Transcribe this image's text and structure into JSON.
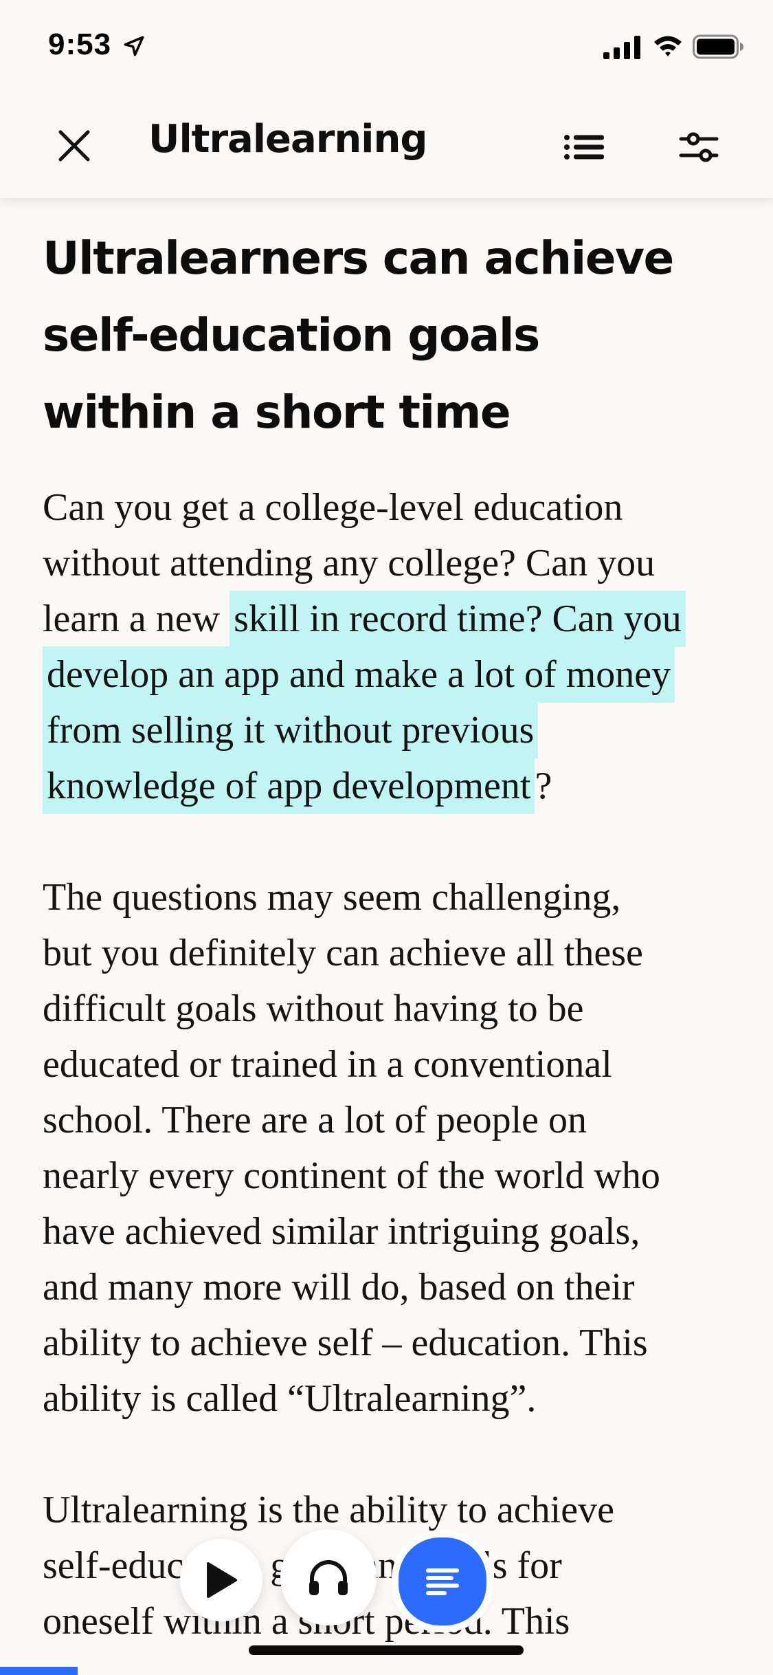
{
  "status_bar": {
    "time": "9:53",
    "icons": [
      "location-arrow-icon",
      "cellular-signal-icon",
      "wifi-icon",
      "battery-icon"
    ]
  },
  "header": {
    "title": "Ultralearning",
    "icons": [
      "close-icon",
      "list-icon",
      "settings-sliders-icon"
    ]
  },
  "chapter": {
    "title_lines": [
      "Ultralearners can achieve",
      "self-education goals",
      "within a short time"
    ],
    "paragraphs": [
      {
        "lines": [
          "Can you get a college-level education",
          "without attending any college? Can you"
        ],
        "hl_prefix": "learn a new ",
        "hl_line1": "skill in record time? Can you",
        "hl_line2": "develop an app and make a lot of money",
        "hl_line3": "from selling it without previous",
        "hl_line4": "knowledge of app development",
        "hl_suffix": "?"
      },
      {
        "lines": [
          "The questions may seem challenging,",
          "but you definitely can achieve all these",
          "difficult goals without having to be",
          "educated or trained in a conventional",
          "school. There are a lot of people on",
          "nearly every continent of the world who",
          "have achieved similar intriguing goals,",
          "and many more will do, based on their",
          "ability to achieve self – education. This",
          "ability is called “Ultralearning”."
        ]
      },
      {
        "lines": [
          "Ultralearning is the ability to achieve",
          "self-education goals and skills for",
          "oneself within a short period. This"
        ]
      }
    ]
  },
  "controls": {
    "highlight_color": "#C2F4F4",
    "accent_color": "#2D6BFF",
    "icons": [
      "play-icon",
      "headphones-icon",
      "text-lines-icon"
    ]
  },
  "reading_progress": 0.1
}
